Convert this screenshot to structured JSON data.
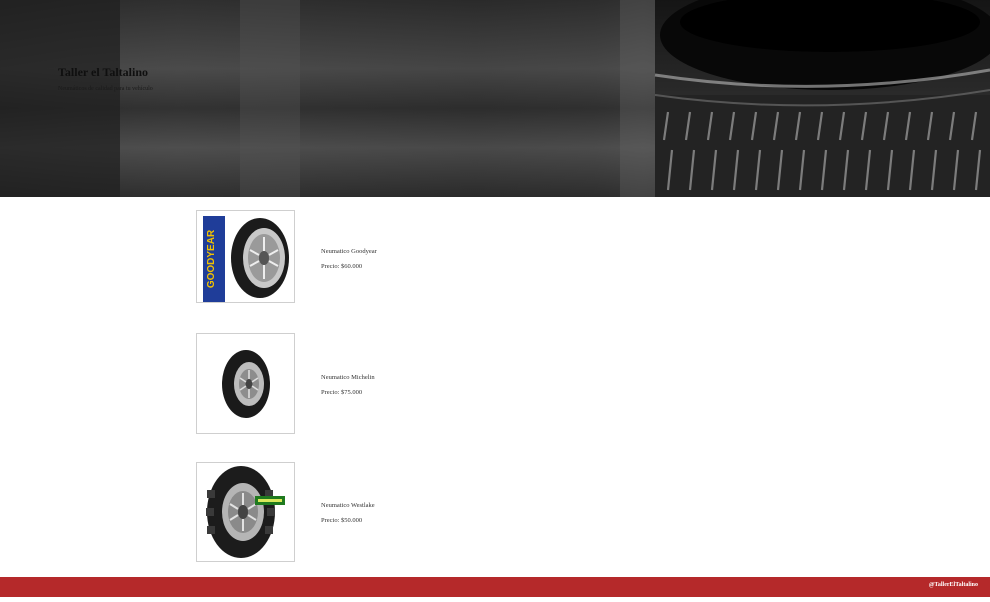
{
  "hero": {
    "title": "Taller el Taltalino",
    "subtitle": "Neumáticos de calidad para tu vehículo"
  },
  "products": [
    {
      "name": "Neumatico Goodyear",
      "price": "Precio: $60.000",
      "brand_logo_text": "GOODYEAR",
      "brand_color": "#1f3d99",
      "logo_accent": "#f2c200"
    },
    {
      "name": "Neumatico Michelin",
      "price": "Precio: $75.000"
    },
    {
      "name": "Neumatico Westlake",
      "price": "Precio: $50.000",
      "sticker_color": "#1f7a1f"
    }
  ],
  "footer": {
    "handle": "@TallerElTaltalino",
    "bg_color": "#b5292a"
  }
}
